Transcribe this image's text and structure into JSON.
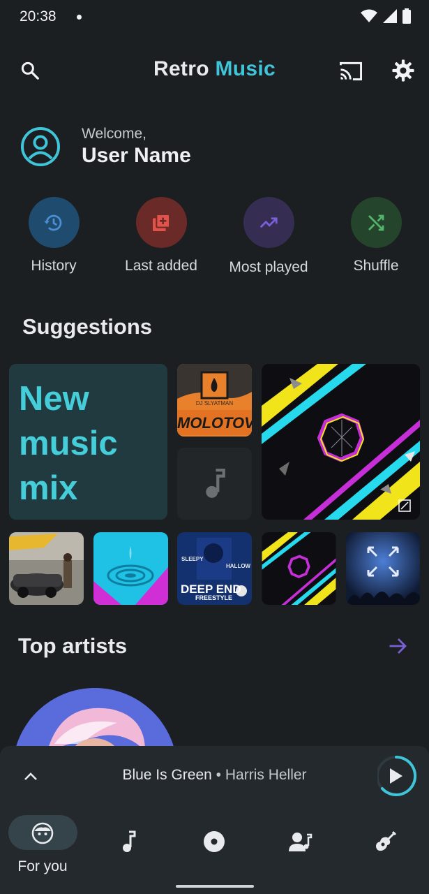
{
  "status_bar": {
    "time": "20:38"
  },
  "app_bar": {
    "title_part1": "Retro",
    "title_part2": "Music"
  },
  "welcome": {
    "greeting": "Welcome,",
    "user_name": "User Name"
  },
  "quick_actions": [
    {
      "label": "History",
      "icon": "history-icon",
      "color": "#1f4c6e"
    },
    {
      "label": "Last added",
      "icon": "library-add-icon",
      "color": "#6a2a27"
    },
    {
      "label": "Most played",
      "icon": "trending-up-icon",
      "color": "#362d52"
    },
    {
      "label": "Shuffle",
      "icon": "shuffle-icon",
      "color": "#24452c"
    }
  ],
  "suggestions": {
    "title": "Suggestions",
    "mix_label": "New music mix",
    "mix_lines": [
      "New",
      "music",
      "mix"
    ],
    "album_art_text": {
      "molotov_artist": "DJ SLYATMAN",
      "molotov_title": "MOLOTOV",
      "deep_end_title": "DEEP END",
      "deep_end_sub": "FREESTYLE",
      "deep_end_left": "SLEEPY",
      "deep_end_right": "HALLOW"
    }
  },
  "top_artists": {
    "title": "Top artists"
  },
  "mini_player": {
    "song": "Blue Is Green",
    "separator": " • ",
    "artist": "Harris Heller"
  },
  "bottom_nav": {
    "active_label": "For you",
    "items": [
      "for-you-icon",
      "music-note-icon",
      "album-icon",
      "artist-icon",
      "genre-guitar-icon"
    ]
  },
  "colors": {
    "accent": "#40c4d8",
    "background": "#1b1f22",
    "surface": "#23292d"
  }
}
